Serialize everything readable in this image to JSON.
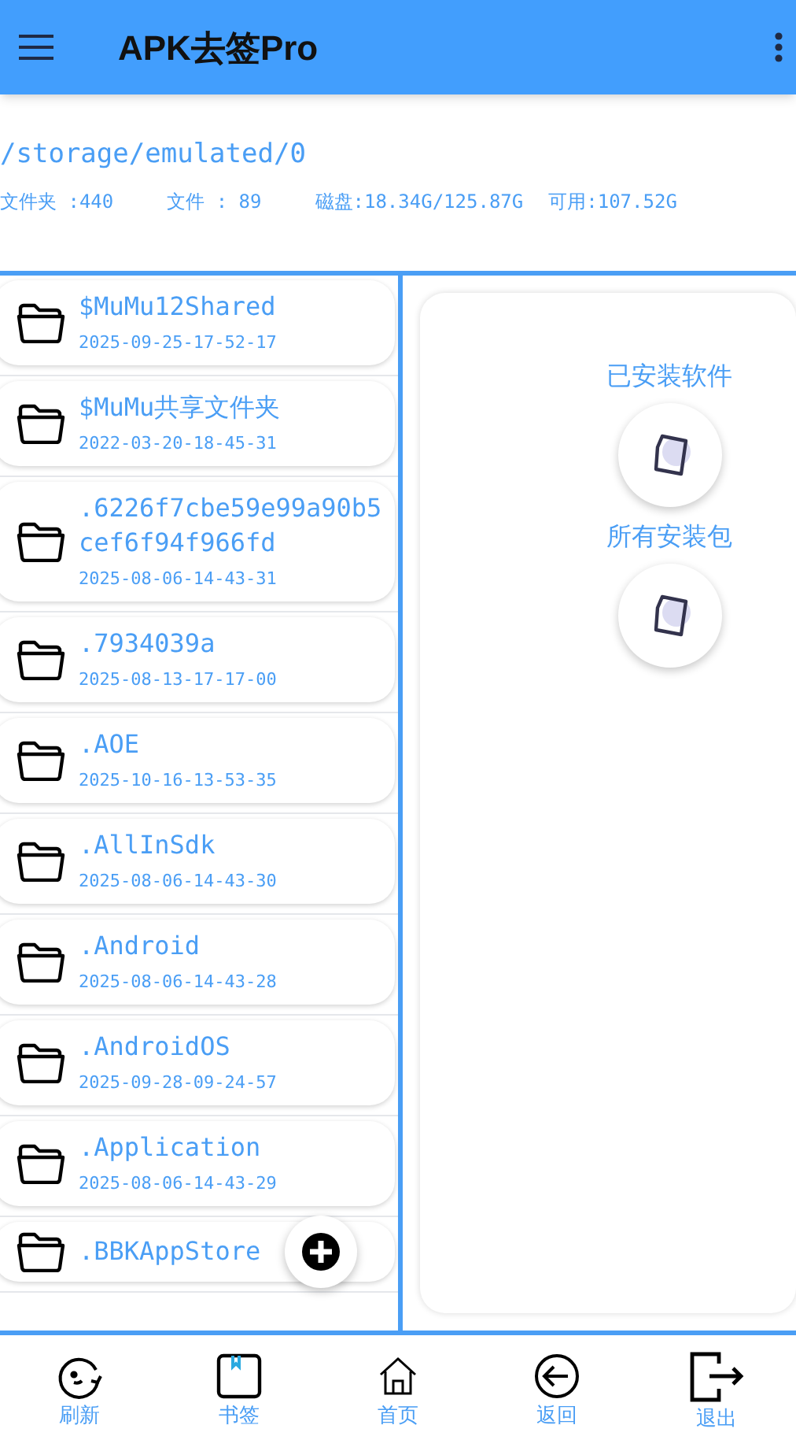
{
  "app_bar": {
    "title": "APK去签Pro"
  },
  "storage": {
    "path": "/storage/emulated/0",
    "folders": "文件夹 :440",
    "files": "文件 : 89",
    "disk": "磁盘:18.34G/125.87G",
    "free": "可用:107.52G"
  },
  "files": [
    {
      "name": "$MuMu12Shared",
      "date": "2025-09-25-17-52-17"
    },
    {
      "name": "$MuMu共享文件夹",
      "date": "2022-03-20-18-45-31"
    },
    {
      "name": ".6226f7cbe59e99a90b5cef6f94f966fd",
      "date": "2025-08-06-14-43-31"
    },
    {
      "name": ".7934039a",
      "date": "2025-08-13-17-17-00"
    },
    {
      "name": ".AOE",
      "date": "2025-10-16-13-53-35"
    },
    {
      "name": ".AllInSdk",
      "date": "2025-08-06-14-43-30"
    },
    {
      "name": ".Android",
      "date": "2025-08-06-14-43-28"
    },
    {
      "name": ".AndroidOS",
      "date": "2025-09-28-09-24-57"
    },
    {
      "name": ".Application",
      "date": "2025-08-06-14-43-29"
    },
    {
      "name": ".BBKAppStore"
    }
  ],
  "shortcuts": [
    {
      "label": "已安装软件"
    },
    {
      "label": "所有安装包"
    }
  ],
  "bottom_nav": [
    {
      "label": "刷新",
      "kind": "refresh"
    },
    {
      "label": "书签",
      "kind": "bookmark"
    },
    {
      "label": "首页",
      "kind": "home"
    },
    {
      "label": "返回",
      "kind": "back"
    },
    {
      "label": "退出",
      "kind": "exit"
    }
  ]
}
